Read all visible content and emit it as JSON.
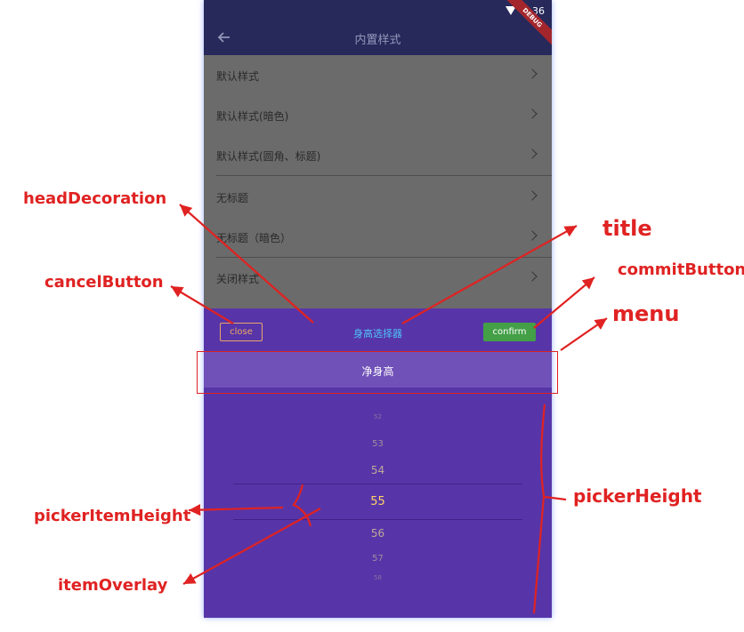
{
  "status_bar": {
    "time": "5:36",
    "debug_label": "DEBUG",
    "wifi_icon": "wifi-icon"
  },
  "app_bar": {
    "title": "内置样式",
    "back_icon": "arrow-left-icon"
  },
  "list": {
    "items": [
      {
        "label": "默认样式"
      },
      {
        "label": "默认样式(暗色)"
      },
      {
        "label": "默认样式(圆角、标题)"
      },
      {
        "label": "无标题"
      },
      {
        "label": "无标题（暗色）"
      },
      {
        "label": "关闭样式"
      }
    ],
    "chevron_icon": "chevron-right-icon"
  },
  "picker_sheet": {
    "cancel_label": "close",
    "title": "身高选择器",
    "confirm_label": "confirm",
    "menu_label": "净身高",
    "items": [
      "52",
      "53",
      "54",
      "55",
      "56",
      "57",
      "58"
    ],
    "selected": "55"
  },
  "annotations": {
    "head_decoration": "headDecoration",
    "title": "title",
    "commit_button": "commitButton",
    "cancel_button": "cancelButton",
    "menu": "menu",
    "picker_item_height": "pickerItemHeight",
    "picker_height": "pickerHeight",
    "item_overlay": "itemOverlay"
  },
  "colors": {
    "app_bar": "#27295a",
    "list_overlay": "#6b6b6b",
    "sheet": "#5735a8",
    "menu_bar": "#7051b8",
    "confirm": "#43a047",
    "cancel_border": "#e8a36b",
    "title": "#4fc3f7",
    "selected_item": "#ffd166",
    "annotation": "#e02222"
  }
}
